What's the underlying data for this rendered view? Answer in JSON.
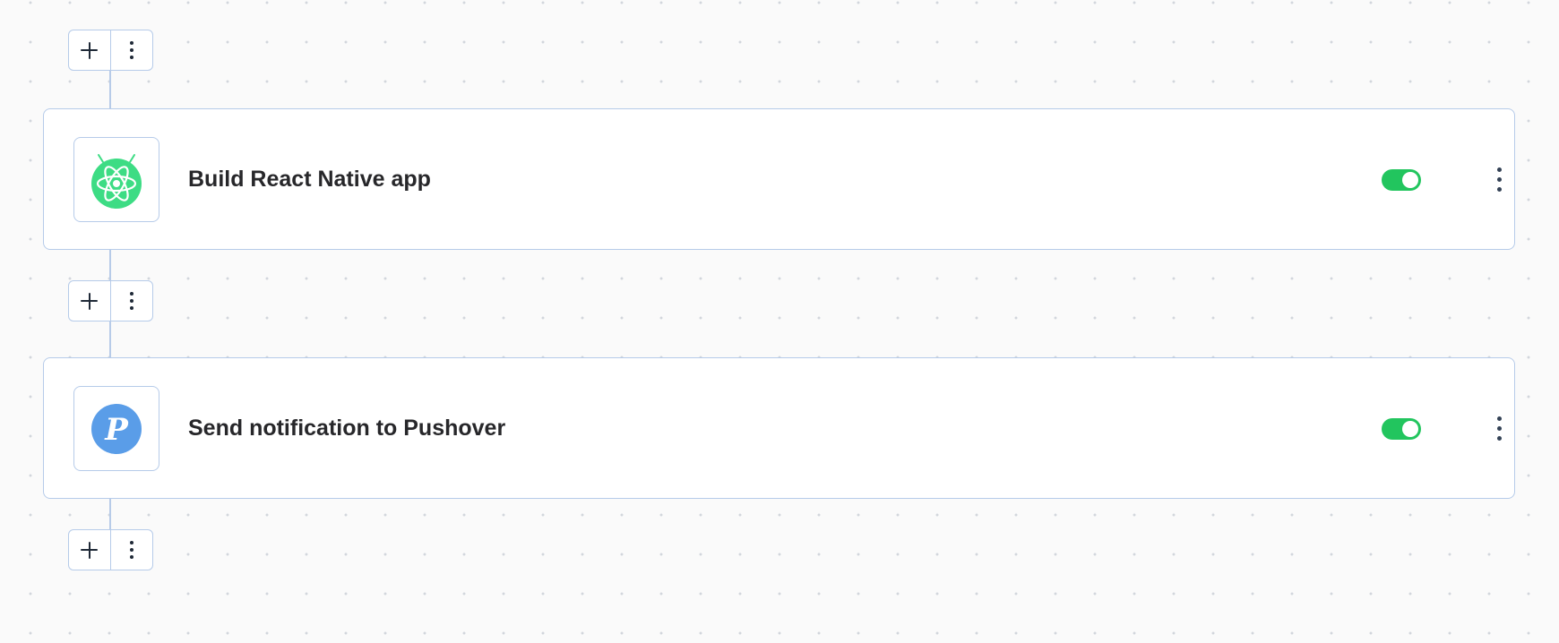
{
  "steps": [
    {
      "title": "Build React Native app",
      "icon": "react-native-android-icon",
      "icon_color": "#3ddc84",
      "enabled": true
    },
    {
      "title": "Send notification to Pushover",
      "icon": "pushover-icon",
      "icon_color": "#5a9de8",
      "icon_glyph": "P",
      "enabled": true
    }
  ],
  "colors": {
    "toggle_on": "#22c55e",
    "border": "#b6cbe9",
    "connector": "#b7cbe8"
  }
}
